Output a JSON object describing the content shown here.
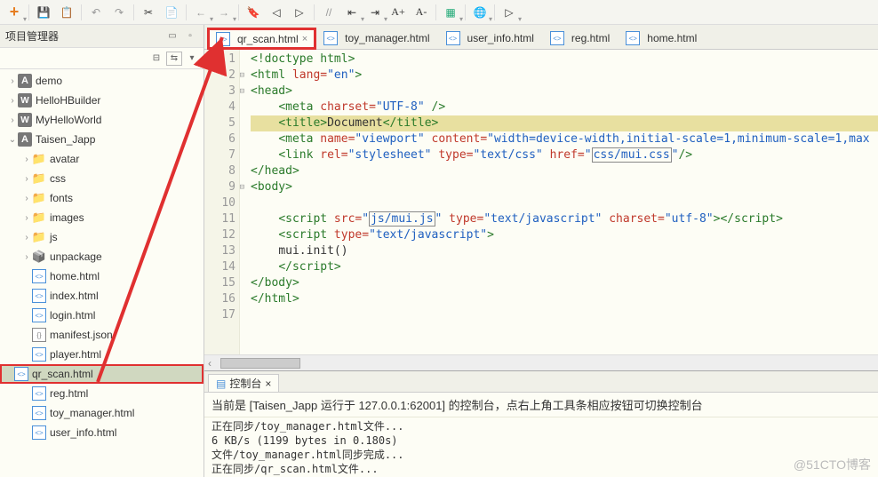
{
  "sidebar": {
    "title": "项目管理器",
    "projects": [
      {
        "name": "demo",
        "icon": "A",
        "expand": ">"
      },
      {
        "name": "HelloHBuilder",
        "icon": "W",
        "expand": ">"
      },
      {
        "name": "MyHelloWorld",
        "icon": "W",
        "expand": ">"
      },
      {
        "name": "Taisen_Japp",
        "icon": "A",
        "expand": "v"
      }
    ],
    "folders": [
      {
        "name": "avatar"
      },
      {
        "name": "css"
      },
      {
        "name": "fonts"
      },
      {
        "name": "images"
      },
      {
        "name": "js"
      }
    ],
    "unpackage": "unpackage",
    "files": [
      {
        "name": "home.html",
        "type": "html"
      },
      {
        "name": "index.html",
        "type": "html"
      },
      {
        "name": "login.html",
        "type": "html"
      },
      {
        "name": "manifest.json",
        "type": "json"
      },
      {
        "name": "player.html",
        "type": "html"
      },
      {
        "name": "qr_scan.html",
        "type": "html",
        "selected": true
      },
      {
        "name": "reg.html",
        "type": "html"
      },
      {
        "name": "toy_manager.html",
        "type": "html"
      },
      {
        "name": "user_info.html",
        "type": "html"
      }
    ]
  },
  "tabs": [
    {
      "label": "qr_scan.html",
      "active": true,
      "close": "×"
    },
    {
      "label": "toy_manager.html",
      "active": false
    },
    {
      "label": "user_info.html",
      "active": false
    },
    {
      "label": "reg.html",
      "active": false
    },
    {
      "label": "home.html",
      "active": false
    }
  ],
  "code": {
    "lines": [
      "1",
      "2",
      "3",
      "4",
      "5",
      "6",
      "7",
      "8",
      "9",
      "10",
      "11",
      "12",
      "13",
      "14",
      "15",
      "16",
      "17"
    ],
    "l1": "<!doctype html>",
    "l2a": "<html",
    "l2b": " lang=",
    "l2c": "\"en\"",
    "l2d": ">",
    "l3": "<head>",
    "l4a": "<meta",
    "l4b": " charset=",
    "l4c": "\"UTF-8\"",
    "l4d": " />",
    "l5a": "<title>",
    "l5b": "Document",
    "l5c": "</title>",
    "l6a": "<meta",
    "l6b": " name=",
    "l6c": "\"viewport\"",
    "l6d": " content=",
    "l6e": "\"width=device-width,initial-scale=1,minimum-scale=1,max",
    "l7a": "<link",
    "l7b": " rel=",
    "l7c": "\"stylesheet\"",
    "l7d": " type=",
    "l7e": "\"text/css\"",
    "l7f": " href=",
    "l7g": "css/mui.css",
    "l7h": "/>",
    "l8": "</head>",
    "l9": "<body>",
    "l11a": "<script",
    "l11b": " src=",
    "l11c": "js/mui.js",
    "l11d": " type=",
    "l11e": "\"text/javascript\"",
    "l11f": " charset=",
    "l11g": "\"utf-8\"",
    "l11h": "></script>",
    "l12a": "<script",
    "l12b": " type=",
    "l12c": "\"text/javascript\"",
    "l12d": ">",
    "l13": "mui.init()",
    "l14": "</script>",
    "l15": "</body>",
    "l16": "</html>"
  },
  "console": {
    "tab": "控制台",
    "close": "×",
    "header": "当前是 [Taisen_Japp 运行于 127.0.0.1:62001] 的控制台，点右上角工具条相应按钮可切换控制台",
    "lines": [
      "正在同步/toy_manager.html文件...",
      "6 KB/s (1199 bytes in 0.180s)",
      "文件/toy_manager.html同步完成...",
      "正在同步/qr_scan.html文件..."
    ]
  },
  "watermark": "@51CTO博客",
  "icons": {
    "minimize": "▭",
    "collapse": "⊟",
    "link": "⇆",
    "menu": "▾",
    "bookmark": "🔖",
    "run": "▷"
  }
}
